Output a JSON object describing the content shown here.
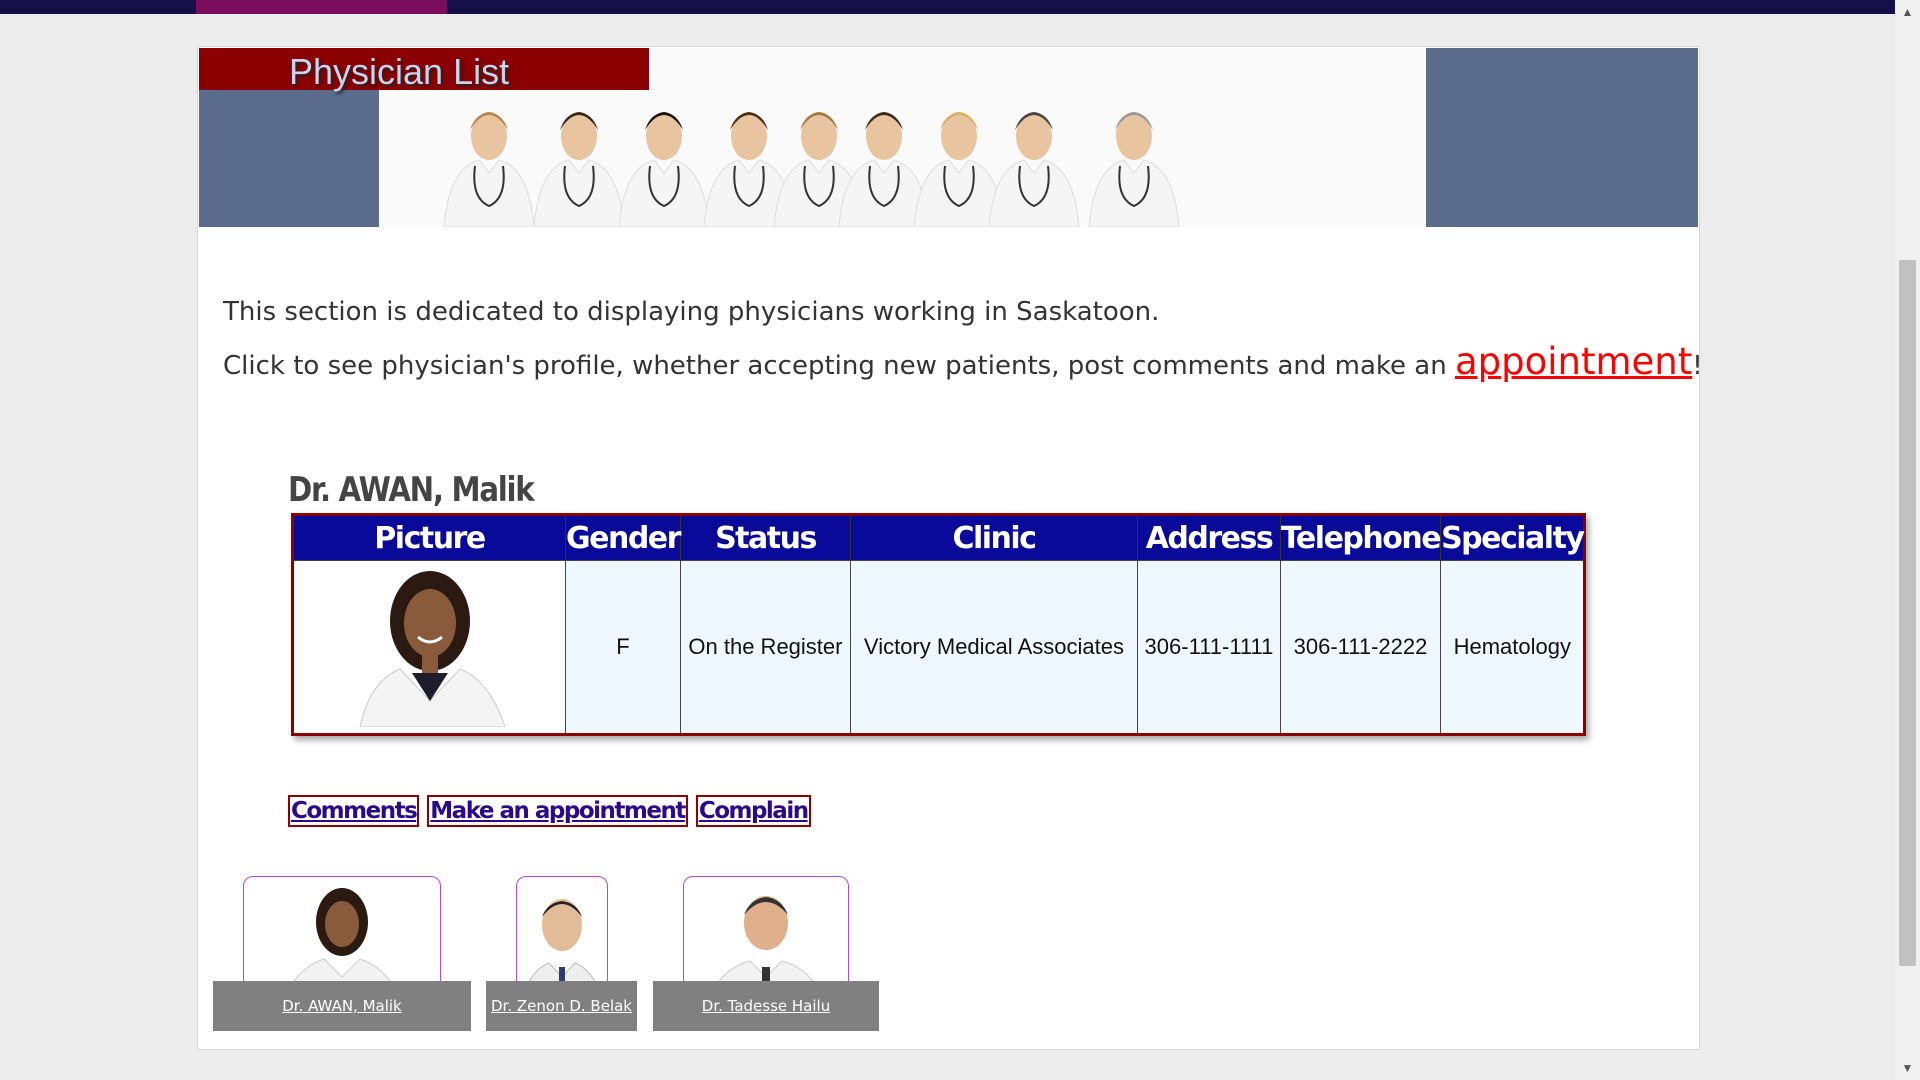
{
  "header": {
    "title": "Physician List"
  },
  "intro": {
    "line1": "This section is dedicated to displaying physicians working in Saskatoon.",
    "line2_prefix": "Click to see physician's profile, whether accepting new patients, post comments and make an ",
    "appointment_link": "appointment",
    "line2_suffix": "!"
  },
  "doctor": {
    "name": "Dr. AWAN, Malik"
  },
  "table": {
    "headers": [
      "Picture",
      "Gender",
      "Status",
      "Clinic",
      "Address",
      "Telephone",
      "Specialty"
    ],
    "row": {
      "gender": "F",
      "status": "On the Register",
      "clinic": "Victory Medical Associates",
      "address": "306-111-1111",
      "telephone": "306-111-2222",
      "specialty": "Hematology"
    }
  },
  "actions": [
    "Comments",
    "Make an appointment",
    "Complain"
  ],
  "physicians": [
    {
      "name": "Dr. AWAN, Malik"
    },
    {
      "name": "Dr. Zenon D. Belak"
    },
    {
      "name": "Dr. Tadesse Hailu"
    }
  ],
  "colors": {
    "topbar": "#15104a",
    "topbar_accent": "#7a0e5c",
    "title_bg": "#8b0000",
    "table_header": "#0a0a9a",
    "table_cell": "#f0f8ff",
    "link_red": "#ff0000",
    "action_text": "#2a0a8a",
    "banner_side": "#5a6b8c"
  },
  "icons": {
    "scroll_up": "triangle-up-icon",
    "scroll_down": "triangle-down-icon"
  }
}
